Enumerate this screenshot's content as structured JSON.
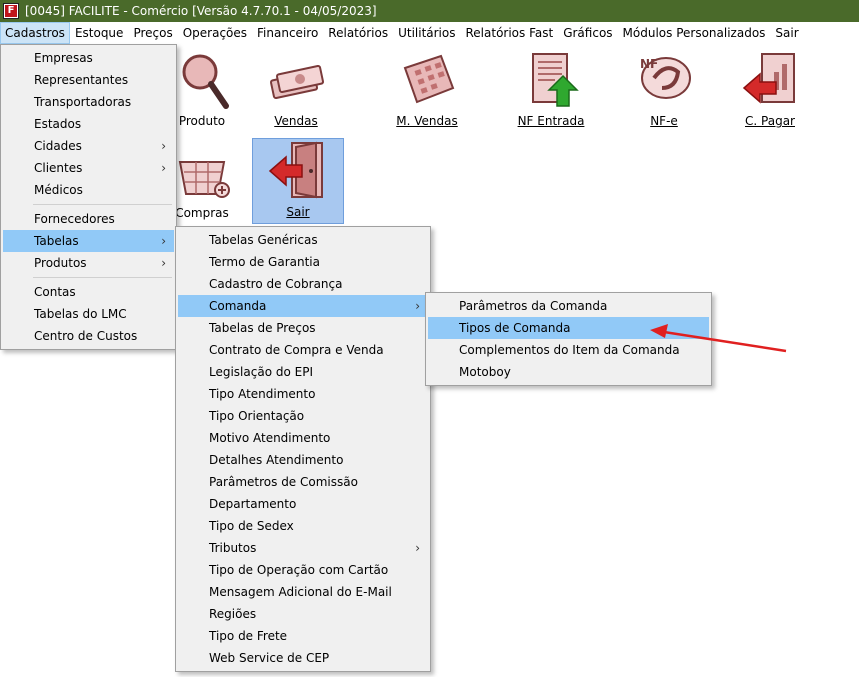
{
  "window": {
    "title": "[0045] FACILITE - Comércio [Versão 4.7.70.1 - 04/05/2023]",
    "app_icon_letter": "F"
  },
  "menubar": [
    "Cadastros",
    "Estoque",
    "Preços",
    "Operações",
    "Financeiro",
    "Relatórios",
    "Utilitários",
    "Relatórios Fast",
    "Gráficos",
    "Módulos Personalizados",
    "Sair"
  ],
  "toolbar": {
    "produto": "Produto",
    "vendas": "Vendas",
    "m_vendas": "M. Vendas",
    "nf_entrada": "NF Entrada",
    "nfe": "NF-e",
    "c_pagar": "C. Pagar",
    "compras": "Compras",
    "sair": "Sair"
  },
  "menu_cadastros": {
    "empresas": "Empresas",
    "representantes": "Representantes",
    "transportadoras": "Transportadoras",
    "estados": "Estados",
    "cidades": "Cidades",
    "clientes": "Clientes",
    "medicos": "Médicos",
    "fornecedores": "Fornecedores",
    "tabelas": "Tabelas",
    "produtos": "Produtos",
    "contas": "Contas",
    "tabelas_lmc": "Tabelas do LMC",
    "centro_custos": "Centro de Custos"
  },
  "menu_tabelas": [
    "Tabelas Genéricas",
    "Termo de Garantia",
    "Cadastro de Cobrança",
    "Comanda",
    "Tabelas de Preços",
    "Contrato de Compra e Venda",
    "Legislação do EPI",
    "Tipo Atendimento",
    "Tipo Orientação",
    "Motivo Atendimento",
    "Detalhes Atendimento",
    "Parâmetros de Comissão",
    "Departamento",
    "Tipo de Sedex",
    "Tributos",
    "Tipo de Operação com Cartão",
    "Mensagem Adicional do E-Mail",
    "Regiões",
    "Tipo de Frete",
    "Web Service de CEP"
  ],
  "menu_comanda": [
    "Parâmetros da Comanda",
    "Tipos de Comanda",
    "Complementos do Item da Comanda",
    "Motoboy"
  ],
  "colors": {
    "titlebar": "#4a6a2a",
    "highlight": "#91c9f7",
    "annotation_arrow": "#e02020"
  }
}
